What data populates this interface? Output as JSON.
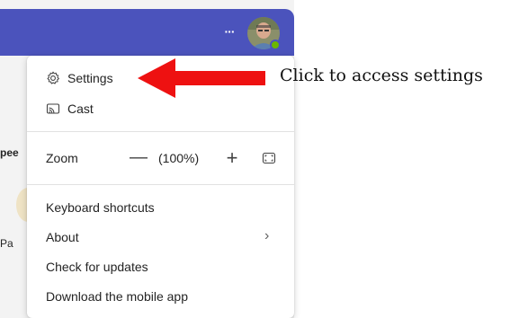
{
  "background": {
    "peek_text_1": "pee",
    "peek_text_2": "Pa"
  },
  "topbar": {
    "more_label": "···",
    "accent_color": "#4b53bc",
    "presence": "available"
  },
  "menu": {
    "settings": {
      "icon": "gear-icon",
      "label": "Settings"
    },
    "cast": {
      "icon": "cast-icon",
      "label": "Cast"
    },
    "zoom": {
      "label": "Zoom",
      "minus": "—",
      "value": "(100%)",
      "plus": "+",
      "fullscreen_icon": "fullscreen-icon"
    },
    "keyboard_shortcuts": "Keyboard shortcuts",
    "about": {
      "label": "About",
      "chevron": "›"
    },
    "check_updates": "Check for updates",
    "download_app": "Download the mobile app"
  },
  "annotation": {
    "text": "Click to access settings",
    "arrow_color": "#ee1111"
  }
}
